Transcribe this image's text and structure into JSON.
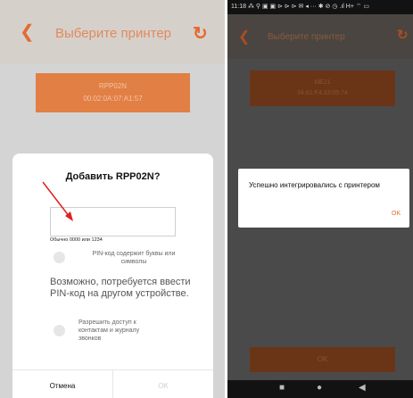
{
  "left": {
    "title": "Выберите принтер",
    "printer": {
      "name": "RPP02N",
      "mac": "00:02:0A:07:A1:57"
    },
    "dialog": {
      "title": "Добавить RPP02N?",
      "pin_value": "",
      "hint": "Обычно 0000 или 1234",
      "pin_letters_label": "PIN-код содержит буквы или символы",
      "maybe_text": "Возможно, потребуется ввести PIN-код на другом устройстве.",
      "allow_access_label": "Разрешить доступ к контактам и журналу звонков",
      "cancel": "Отмена",
      "ok": "OK"
    }
  },
  "right": {
    "status_time": "11:18",
    "status_icons": "⁂ ⚲ ▣ ▣ ⊳ ⊳ ⊳ ✉ ◂ ···  ✱ ⊘ ◷ .ıl H+ ⌔ ▭",
    "title": "Выберите принтер",
    "printer": {
      "name": "ME21",
      "mac": "34:81:F4:33:05:74"
    },
    "alert": {
      "message": "Успешно интегрировались с принтером",
      "ok": "OK"
    },
    "bottom_ok": "OK"
  },
  "colors": {
    "accent": "#e46a2f",
    "card": "#e27f44"
  },
  "icons": [
    "back-arrow-icon",
    "refresh-icon",
    "nav-stop-icon",
    "nav-home-icon",
    "nav-back-icon"
  ]
}
